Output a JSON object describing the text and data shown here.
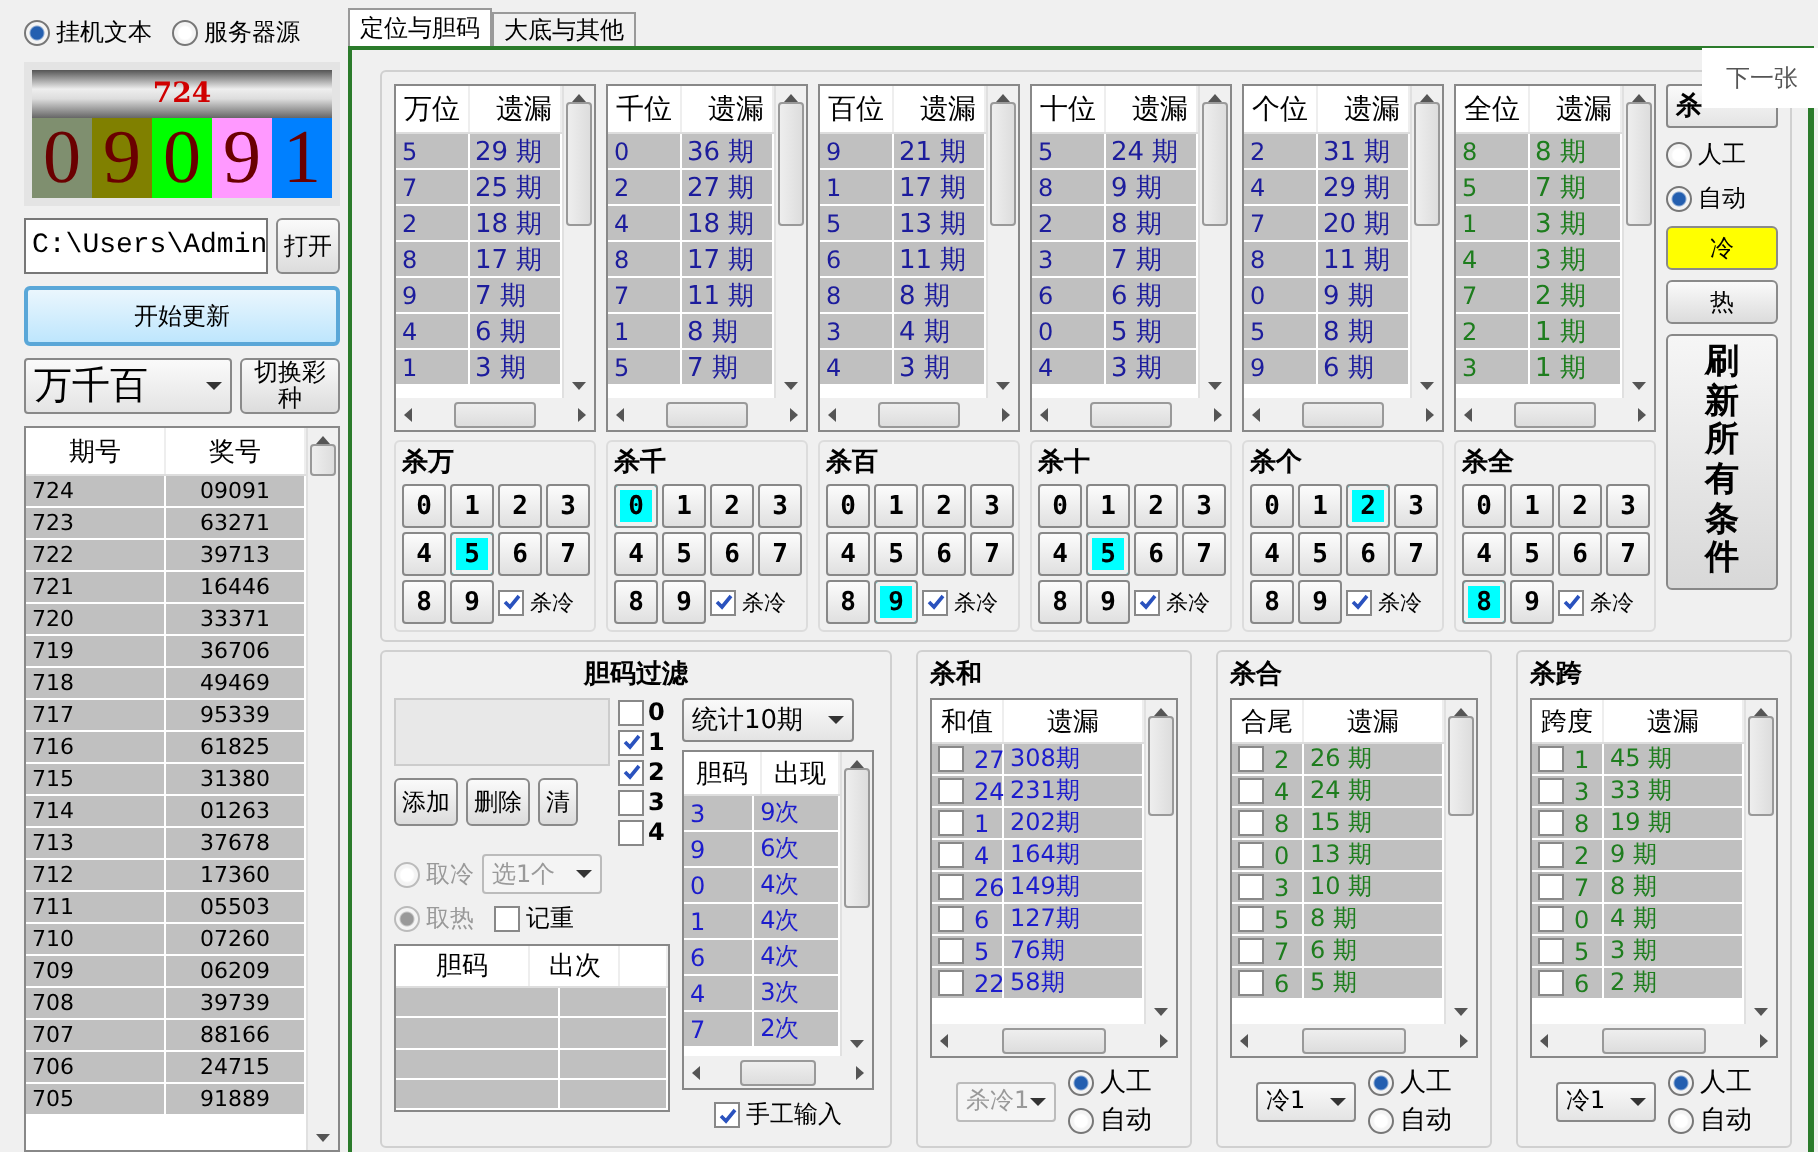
{
  "source_radios": [
    {
      "label": "挂机文本",
      "selected": true
    },
    {
      "label": "服务器源",
      "selected": false
    }
  ],
  "current": {
    "issue": "724",
    "digits": [
      {
        "value": "0",
        "color": "#7f8f6f"
      },
      {
        "value": "9",
        "color": "#808000"
      },
      {
        "value": "0",
        "color": "#00ff00"
      },
      {
        "value": "9",
        "color": "#ff99ff"
      },
      {
        "value": "1",
        "color": "#0080ff"
      }
    ]
  },
  "path": {
    "value": "C:\\Users\\Admin",
    "button": "打开"
  },
  "start_button": "开始更新",
  "mode_select": "万千百",
  "switch_button": "切换彩种",
  "history": {
    "columns": [
      "期号",
      "奖号"
    ],
    "rows": [
      [
        "724",
        "09091"
      ],
      [
        "723",
        "63271"
      ],
      [
        "722",
        "39713"
      ],
      [
        "721",
        "16446"
      ],
      [
        "720",
        "33371"
      ],
      [
        "719",
        "36706"
      ],
      [
        "718",
        "49469"
      ],
      [
        "717",
        "95339"
      ],
      [
        "716",
        "61825"
      ],
      [
        "715",
        "31380"
      ],
      [
        "714",
        "01263"
      ],
      [
        "713",
        "37678"
      ],
      [
        "712",
        "17360"
      ],
      [
        "711",
        "05503"
      ],
      [
        "710",
        "07260"
      ],
      [
        "709",
        "06209"
      ],
      [
        "708",
        "39739"
      ],
      [
        "707",
        "88166"
      ],
      [
        "706",
        "24715"
      ],
      [
        "705",
        "91889"
      ]
    ]
  },
  "tabs": [
    {
      "label": "定位与胆码",
      "selected": true
    },
    {
      "label": "大底与其他",
      "selected": false
    }
  ],
  "positions": [
    {
      "header": "万位",
      "miss_header": "遗漏",
      "color": "#1c1c9c",
      "rows": [
        [
          "5",
          "29 期"
        ],
        [
          "7",
          "25 期"
        ],
        [
          "2",
          "18 期"
        ],
        [
          "8",
          "17 期"
        ],
        [
          "9",
          "7 期"
        ],
        [
          "4",
          "6 期"
        ],
        [
          "1",
          "3 期"
        ]
      ],
      "kill_title": "杀万",
      "keys": [
        {
          "label": "0",
          "selected": false
        },
        {
          "label": "1",
          "selected": false
        },
        {
          "label": "2",
          "selected": false
        },
        {
          "label": "3",
          "selected": false
        },
        {
          "label": "4",
          "selected": false
        },
        {
          "label": "5",
          "selected": true
        },
        {
          "label": "6",
          "selected": false
        },
        {
          "label": "7",
          "selected": false
        },
        {
          "label": "8",
          "selected": false
        },
        {
          "label": "9",
          "selected": false
        }
      ],
      "kill_cold": {
        "label": "杀冷",
        "checked": true
      }
    },
    {
      "header": "千位",
      "miss_header": "遗漏",
      "color": "#1c1c9c",
      "rows": [
        [
          "0",
          "36 期"
        ],
        [
          "2",
          "27 期"
        ],
        [
          "4",
          "18 期"
        ],
        [
          "8",
          "17 期"
        ],
        [
          "7",
          "11 期"
        ],
        [
          "1",
          "8 期"
        ],
        [
          "5",
          "7 期"
        ]
      ],
      "kill_title": "杀千",
      "keys": [
        {
          "label": "0",
          "selected": true
        },
        {
          "label": "1",
          "selected": false
        },
        {
          "label": "2",
          "selected": false
        },
        {
          "label": "3",
          "selected": false
        },
        {
          "label": "4",
          "selected": false
        },
        {
          "label": "5",
          "selected": false
        },
        {
          "label": "6",
          "selected": false
        },
        {
          "label": "7",
          "selected": false
        },
        {
          "label": "8",
          "selected": false
        },
        {
          "label": "9",
          "selected": false
        }
      ],
      "kill_cold": {
        "label": "杀冷",
        "checked": true
      }
    },
    {
      "header": "百位",
      "miss_header": "遗漏",
      "color": "#1c1c9c",
      "rows": [
        [
          "9",
          "21 期"
        ],
        [
          "1",
          "17 期"
        ],
        [
          "5",
          "13 期"
        ],
        [
          "6",
          "11 期"
        ],
        [
          "8",
          "8 期"
        ],
        [
          "3",
          "4 期"
        ],
        [
          "4",
          "3 期"
        ]
      ],
      "kill_title": "杀百",
      "keys": [
        {
          "label": "0",
          "selected": false
        },
        {
          "label": "1",
          "selected": false
        },
        {
          "label": "2",
          "selected": false
        },
        {
          "label": "3",
          "selected": false
        },
        {
          "label": "4",
          "selected": false
        },
        {
          "label": "5",
          "selected": false
        },
        {
          "label": "6",
          "selected": false
        },
        {
          "label": "7",
          "selected": false
        },
        {
          "label": "8",
          "selected": false
        },
        {
          "label": "9",
          "selected": true
        }
      ],
      "kill_cold": {
        "label": "杀冷",
        "checked": true
      }
    },
    {
      "header": "十位",
      "miss_header": "遗漏",
      "color": "#1c1c9c",
      "rows": [
        [
          "5",
          "24 期"
        ],
        [
          "8",
          "9 期"
        ],
        [
          "2",
          "8 期"
        ],
        [
          "3",
          "7 期"
        ],
        [
          "6",
          "6 期"
        ],
        [
          "0",
          "5 期"
        ],
        [
          "4",
          "3 期"
        ]
      ],
      "kill_title": "杀十",
      "keys": [
        {
          "label": "0",
          "selected": false
        },
        {
          "label": "1",
          "selected": false
        },
        {
          "label": "2",
          "selected": false
        },
        {
          "label": "3",
          "selected": false
        },
        {
          "label": "4",
          "selected": false
        },
        {
          "label": "5",
          "selected": true
        },
        {
          "label": "6",
          "selected": false
        },
        {
          "label": "7",
          "selected": false
        },
        {
          "label": "8",
          "selected": false
        },
        {
          "label": "9",
          "selected": false
        }
      ],
      "kill_cold": {
        "label": "杀冷",
        "checked": true
      }
    },
    {
      "header": "个位",
      "miss_header": "遗漏",
      "color": "#1c1c9c",
      "rows": [
        [
          "2",
          "31 期"
        ],
        [
          "4",
          "29 期"
        ],
        [
          "7",
          "20 期"
        ],
        [
          "8",
          "11 期"
        ],
        [
          "0",
          "9 期"
        ],
        [
          "5",
          "8 期"
        ],
        [
          "9",
          "6 期"
        ]
      ],
      "kill_title": "杀个",
      "keys": [
        {
          "label": "0",
          "selected": false
        },
        {
          "label": "1",
          "selected": false
        },
        {
          "label": "2",
          "selected": true
        },
        {
          "label": "3",
          "selected": false
        },
        {
          "label": "4",
          "selected": false
        },
        {
          "label": "5",
          "selected": false
        },
        {
          "label": "6",
          "selected": false
        },
        {
          "label": "7",
          "selected": false
        },
        {
          "label": "8",
          "selected": false
        },
        {
          "label": "9",
          "selected": false
        }
      ],
      "kill_cold": {
        "label": "杀冷",
        "checked": true
      }
    },
    {
      "header": "全位",
      "miss_header": "遗漏",
      "color": "#1e7d1e",
      "rows": [
        [
          "8",
          "8 期"
        ],
        [
          "5",
          "7 期"
        ],
        [
          "1",
          "3 期"
        ],
        [
          "4",
          "3 期"
        ],
        [
          "7",
          "2 期"
        ],
        [
          "2",
          "1 期"
        ],
        [
          "3",
          "1 期"
        ]
      ],
      "kill_title": "杀全",
      "keys": [
        {
          "label": "0",
          "selected": false
        },
        {
          "label": "1",
          "selected": false
        },
        {
          "label": "2",
          "selected": false
        },
        {
          "label": "3",
          "selected": false
        },
        {
          "label": "4",
          "selected": false
        },
        {
          "label": "5",
          "selected": false
        },
        {
          "label": "6",
          "selected": false
        },
        {
          "label": "7",
          "selected": false
        },
        {
          "label": "8",
          "selected": true
        },
        {
          "label": "9",
          "selected": false
        }
      ],
      "kill_cold": {
        "label": "杀冷",
        "checked": true
      }
    }
  ],
  "side": {
    "select": "杀",
    "radios": [
      {
        "label": "人工",
        "selected": false
      },
      {
        "label": "自动",
        "selected": true
      }
    ],
    "temp_buttons": [
      {
        "label": "冷",
        "selected": true
      },
      {
        "label": "热",
        "selected": false
      }
    ],
    "refresh_button": "刷新所有条件"
  },
  "overlay_button": "下一张",
  "dan_filter": {
    "title": "胆码过滤",
    "buttons": [
      "添加",
      "删除",
      "清"
    ],
    "checks": [
      {
        "label": "0",
        "checked": false
      },
      {
        "label": "1",
        "checked": true
      },
      {
        "label": "2",
        "checked": true
      },
      {
        "label": "3",
        "checked": false
      },
      {
        "label": "4",
        "checked": false
      }
    ],
    "radios": [
      {
        "label": "取冷",
        "selected": false
      },
      {
        "label": "取热",
        "selected": true
      }
    ],
    "pick_select": "选1个",
    "repeat_check": {
      "label": "记重",
      "checked": false
    },
    "result_columns": [
      "胆码",
      "出次"
    ],
    "stats_select": "统计10期",
    "stats_columns": [
      "胆码",
      "出现"
    ],
    "stats_rows": [
      [
        "3",
        "9次"
      ],
      [
        "9",
        "6次"
      ],
      [
        "0",
        "4次"
      ],
      [
        "1",
        "4次"
      ],
      [
        "6",
        "4次"
      ],
      [
        "4",
        "3次"
      ],
      [
        "7",
        "2次"
      ]
    ],
    "manual_check": {
      "label": "手工输入",
      "checked": true
    }
  },
  "kill_panels": [
    {
      "title": "杀和",
      "columns": [
        "和值",
        "遗漏"
      ],
      "color": "#1c1ccc",
      "rows": [
        {
          "checked": false,
          "value": "27",
          "miss": "308期"
        },
        {
          "checked": false,
          "value": "24",
          "miss": "231期"
        },
        {
          "checked": false,
          "value": "1",
          "miss": "202期"
        },
        {
          "checked": false,
          "value": "4",
          "miss": "164期"
        },
        {
          "checked": false,
          "value": "26",
          "miss": "149期"
        },
        {
          "checked": false,
          "value": "6",
          "miss": "127期"
        },
        {
          "checked": false,
          "value": "5",
          "miss": "76期"
        },
        {
          "checked": false,
          "value": "22",
          "miss": "58期"
        }
      ],
      "select": "杀冷1",
      "select_disabled": true,
      "radios": [
        {
          "label": "人工",
          "selected": true
        },
        {
          "label": "自动",
          "selected": false
        }
      ]
    },
    {
      "title": "杀合",
      "columns": [
        "合尾",
        "遗漏"
      ],
      "color": "#1e7d1e",
      "rows": [
        {
          "checked": false,
          "value": "2",
          "miss": "26 期"
        },
        {
          "checked": false,
          "value": "4",
          "miss": "24 期"
        },
        {
          "checked": false,
          "value": "8",
          "miss": "15 期"
        },
        {
          "checked": false,
          "value": "0",
          "miss": "13 期"
        },
        {
          "checked": false,
          "value": "3",
          "miss": "10 期"
        },
        {
          "checked": false,
          "value": "5",
          "miss": "8 期"
        },
        {
          "checked": false,
          "value": "7",
          "miss": "6 期"
        },
        {
          "checked": false,
          "value": "6",
          "miss": "5 期"
        }
      ],
      "select": "冷1",
      "select_disabled": false,
      "radios": [
        {
          "label": "人工",
          "selected": true
        },
        {
          "label": "自动",
          "selected": false
        }
      ]
    },
    {
      "title": "杀跨",
      "columns": [
        "跨度",
        "遗漏"
      ],
      "color": "#1e7d1e",
      "rows": [
        {
          "checked": false,
          "value": "1",
          "miss": "45 期"
        },
        {
          "checked": false,
          "value": "3",
          "miss": "33 期"
        },
        {
          "checked": false,
          "value": "8",
          "miss": "19 期"
        },
        {
          "checked": false,
          "value": "2",
          "miss": "9 期"
        },
        {
          "checked": false,
          "value": "7",
          "miss": "8 期"
        },
        {
          "checked": false,
          "value": "0",
          "miss": "4 期"
        },
        {
          "checked": false,
          "value": "5",
          "miss": "3 期"
        },
        {
          "checked": false,
          "value": "6",
          "miss": "2 期"
        }
      ],
      "select": "冷1",
      "select_disabled": false,
      "radios": [
        {
          "label": "人工",
          "selected": true
        },
        {
          "label": "自动",
          "selected": false
        }
      ]
    }
  ]
}
